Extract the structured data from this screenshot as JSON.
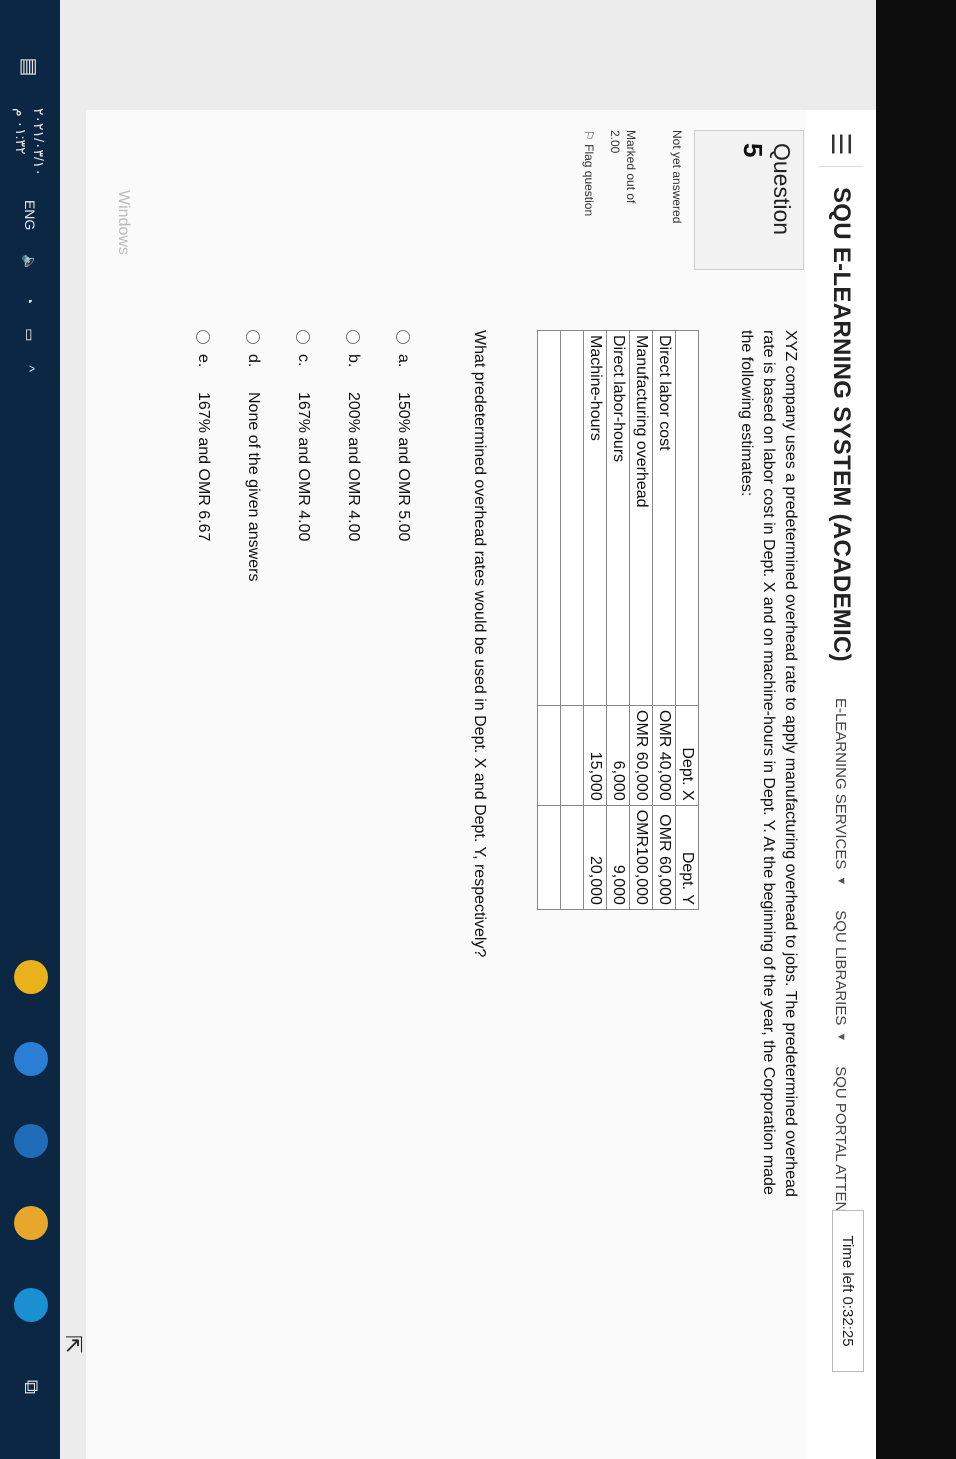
{
  "navbar": {
    "title": "SQU E-LEARNING SYSTEM (ACADEMIC)",
    "links": [
      "E-LEARNING SERVICES",
      "SQU LIBRARIES",
      "SQU PORTAL ATTENDANC"
    ]
  },
  "quiz": {
    "time_left": "Time left 0:32:25",
    "question_label": "Question",
    "question_number": "5",
    "status": "Not yet answered",
    "marks_label": "Marked out of",
    "marks_value": "2.00",
    "flag_label": "Flag question",
    "question_text": "XYZ company uses a predetermined overhead rate to apply manufacturing overhead to jobs. The predetermined overhead rate is based on labor cost in Dept. X and on machine-hours in Dept. Y. At the beginning of the year, the Corporation made the following estimates:",
    "prompt": "What predetermined overhead rates would be used in Dept. X and Dept. Y, respectively?"
  },
  "table": {
    "headers": [
      "Dept. X",
      "Dept. Y"
    ],
    "rows": [
      {
        "label": "Direct labor cost",
        "x": "OMR 40,000",
        "y": "OMR 60,000"
      },
      {
        "label": "Manufacturing overhead",
        "x": "OMR 60,000",
        "y": "OMR100,000"
      },
      {
        "label": "Direct labor-hours",
        "x": "6,000",
        "y": "9,000"
      },
      {
        "label": "Machine-hours",
        "x": "15,000",
        "y": "20,000"
      }
    ]
  },
  "options": [
    {
      "letter": "a.",
      "text": "150% and OMR 5.00"
    },
    {
      "letter": "b.",
      "text": "200% and OMR 4.00"
    },
    {
      "letter": "c.",
      "text": "167% and OMR 4.00"
    },
    {
      "letter": "d.",
      "text": "None of the given answers"
    },
    {
      "letter": "e.",
      "text": "167% and OMR 6.67"
    }
  ],
  "watermark": "Windows",
  "taskbar": {
    "time": "٠١:٣٢ م",
    "date": "٢٠٢١/٠٣/١٠",
    "language": "ENG"
  }
}
